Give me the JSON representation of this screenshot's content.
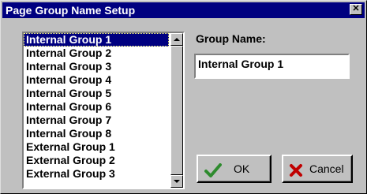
{
  "window": {
    "title": "Page Group Name Setup",
    "close_symbol": "✕"
  },
  "list": {
    "items": [
      "Internal Group 1",
      "Internal Group 2",
      "Internal Group 3",
      "Internal Group 4",
      "Internal Group 5",
      "Internal Group 6",
      "Internal Group 7",
      "Internal Group 8",
      "External Group 1",
      "External Group 2",
      "External Group 3"
    ],
    "selected_index": 0
  },
  "form": {
    "group_name_label": "Group Name:",
    "group_name_value": "Internal Group 1"
  },
  "buttons": {
    "ok_label": "OK",
    "cancel_label": "Cancel",
    "ok_icon": "check-icon",
    "cancel_icon": "x-icon"
  },
  "colors": {
    "titlebar": "#000080",
    "selection": "#000080",
    "check": "#2e8b2e",
    "x": "#c00000"
  }
}
